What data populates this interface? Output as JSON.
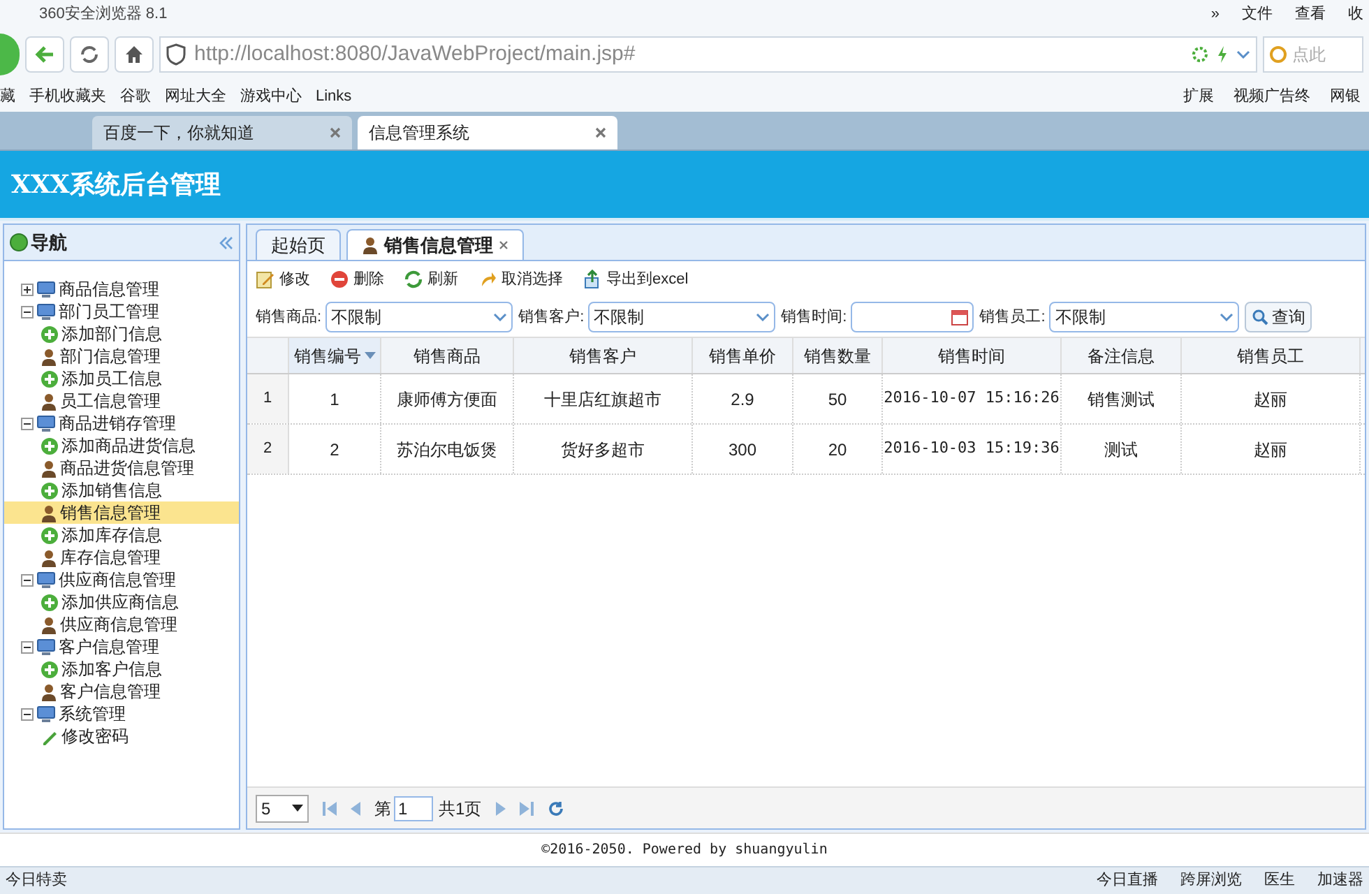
{
  "browser": {
    "title": "360安全浏览器 8.1",
    "menu": [
      "»",
      "文件",
      "查看",
      "收"
    ],
    "url": "http://localhost:8080/JavaWebProject/main.jsp#",
    "search_placeholder": "点此",
    "bookmarks_left": [
      "藏",
      "手机收藏夹",
      "谷歌",
      "网址大全",
      "游戏中心",
      "Links"
    ],
    "bookmarks_right": [
      "扩展",
      "视频广告终",
      "网银"
    ],
    "tabs": [
      {
        "label": "百度一下，你就知道",
        "selected": false
      },
      {
        "label": "信息管理系统",
        "selected": true
      }
    ]
  },
  "header": {
    "title": "XXX系统后台管理"
  },
  "nav": {
    "title": "导航",
    "items": [
      {
        "label": "商品信息管理",
        "kind": "folder",
        "expanded": false,
        "selected": false
      },
      {
        "label": "部门员工管理",
        "kind": "folder",
        "expanded": true,
        "selected": false,
        "children": [
          {
            "label": "添加部门信息",
            "kind": "add",
            "selected": false
          },
          {
            "label": "部门信息管理",
            "kind": "user",
            "selected": false
          },
          {
            "label": "添加员工信息",
            "kind": "add",
            "selected": false
          },
          {
            "label": "员工信息管理",
            "kind": "user",
            "selected": false
          }
        ]
      },
      {
        "label": "商品进销存管理",
        "kind": "folder",
        "expanded": true,
        "selected": false,
        "children": [
          {
            "label": "添加商品进货信息",
            "kind": "add",
            "selected": false
          },
          {
            "label": "商品进货信息管理",
            "kind": "user",
            "selected": false
          },
          {
            "label": "添加销售信息",
            "kind": "add",
            "selected": false
          },
          {
            "label": "销售信息管理",
            "kind": "user",
            "selected": true
          },
          {
            "label": "添加库存信息",
            "kind": "add",
            "selected": false
          },
          {
            "label": "库存信息管理",
            "kind": "user",
            "selected": false
          }
        ]
      },
      {
        "label": "供应商信息管理",
        "kind": "folder",
        "expanded": true,
        "selected": false,
        "children": [
          {
            "label": "添加供应商信息",
            "kind": "add",
            "selected": false
          },
          {
            "label": "供应商信息管理",
            "kind": "user",
            "selected": false
          }
        ]
      },
      {
        "label": "客户信息管理",
        "kind": "folder",
        "expanded": true,
        "selected": false,
        "children": [
          {
            "label": "添加客户信息",
            "kind": "add",
            "selected": false
          },
          {
            "label": "客户信息管理",
            "kind": "user",
            "selected": false
          }
        ]
      },
      {
        "label": "系统管理",
        "kind": "folder",
        "expanded": true,
        "selected": false,
        "children": [
          {
            "label": "修改密码",
            "kind": "edit",
            "selected": false
          }
        ]
      }
    ]
  },
  "content_tabs": [
    {
      "label": "起始页",
      "selected": false,
      "closable": false
    },
    {
      "label": "销售信息管理",
      "selected": true,
      "closable": true
    }
  ],
  "toolbar": [
    {
      "label": "修改",
      "kind": "edit"
    },
    {
      "label": "删除",
      "kind": "delete"
    },
    {
      "label": "刷新",
      "kind": "refresh"
    },
    {
      "label": "取消选择",
      "kind": "undo"
    },
    {
      "label": "导出到excel",
      "kind": "export"
    }
  ],
  "filters": [
    {
      "label": "销售商品:",
      "kind": "select",
      "value": "不限制"
    },
    {
      "label": "销售客户:",
      "kind": "select",
      "value": "不限制"
    },
    {
      "label": "销售时间:",
      "kind": "date"
    },
    {
      "label": "销售员工:",
      "kind": "select",
      "value": "不限制"
    }
  ],
  "query_button": "查询",
  "table": {
    "columns": [
      {
        "label": "销售编号",
        "sorted": true
      },
      {
        "label": "销售商品",
        "sorted": false
      },
      {
        "label": "销售客户",
        "sorted": false
      },
      {
        "label": "销售单价",
        "sorted": false
      },
      {
        "label": "销售数量",
        "sorted": false
      },
      {
        "label": "销售时间",
        "sorted": false
      },
      {
        "label": "备注信息",
        "sorted": false
      },
      {
        "label": "销售员工",
        "sorted": false
      }
    ],
    "rows": [
      {
        "number": "1",
        "cells": [
          "1",
          "康师傅方便面",
          "十里店红旗超市",
          "2.9",
          "50",
          "2016-10-07 15:16:26",
          "销售测试",
          "赵丽"
        ]
      },
      {
        "number": "2",
        "cells": [
          "2",
          "苏泊尔电饭煲",
          "货好多超市",
          "300",
          "20",
          "2016-10-03 15:19:36",
          "测试",
          "赵丽"
        ]
      }
    ]
  },
  "pager": {
    "page_size": "5",
    "page_prefix": "第",
    "page": "1",
    "page_total": "共1页"
  },
  "footer": "©2016-2050. Powered by shuangyulin",
  "status_bar": {
    "left": "今日特卖",
    "right": [
      "今日直播",
      "跨屏浏览",
      "医生",
      "加速器"
    ]
  }
}
